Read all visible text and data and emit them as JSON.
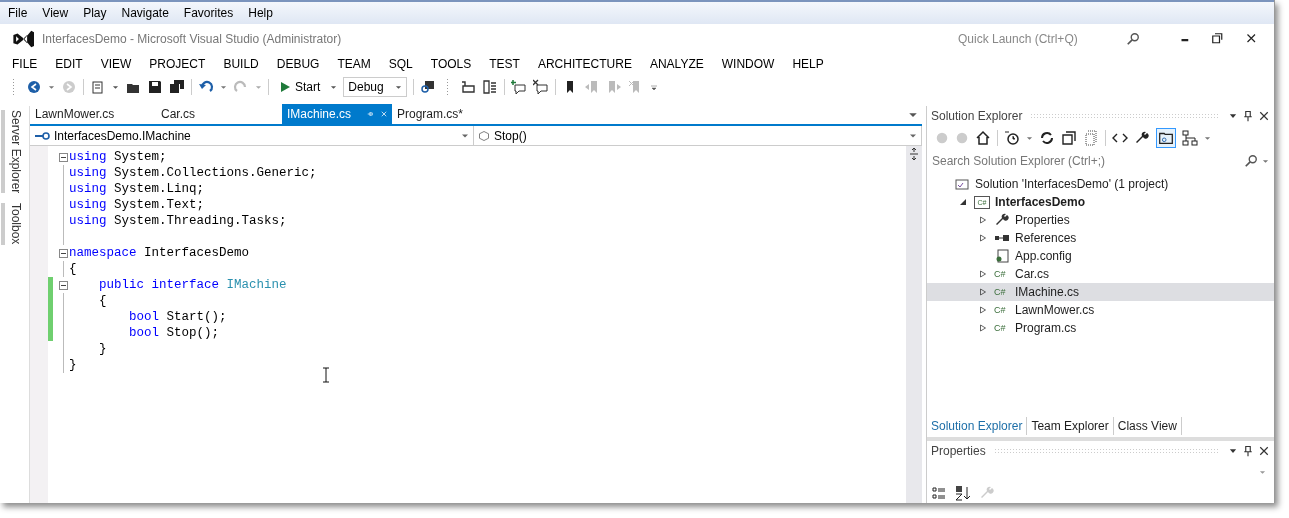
{
  "browser_menu": [
    "File",
    "View",
    "Play",
    "Navigate",
    "Favorites",
    "Help"
  ],
  "window": {
    "title": "InterfacesDemo - Microsoft Visual Studio (Administrator)",
    "quick_launch": {
      "placeholder": "Quick Launch (Ctrl+Q)"
    }
  },
  "menu": [
    "FILE",
    "EDIT",
    "VIEW",
    "PROJECT",
    "BUILD",
    "DEBUG",
    "TEAM",
    "SQL",
    "TOOLS",
    "TEST",
    "ARCHITECTURE",
    "ANALYZE",
    "WINDOW",
    "HELP"
  ],
  "toolbar": {
    "start": "Start",
    "configuration": "Debug"
  },
  "side_tabs": [
    "Server Explorer",
    "Toolbox"
  ],
  "doc_tabs": [
    {
      "label": "LawnMower.cs",
      "selected": false
    },
    {
      "label": "Car.cs",
      "selected": false
    },
    {
      "label": "IMachine.cs",
      "selected": true
    },
    {
      "label": "Program.cs*",
      "selected": false
    }
  ],
  "nav_bar": {
    "type": "InterfacesDemo.IMachine",
    "member": "Stop()"
  },
  "code_lines": [
    {
      "fold": true,
      "changed": false,
      "tokens": [
        {
          "kind": "keyword",
          "text": "using"
        },
        {
          "kind": "plain",
          "text": " System;"
        }
      ]
    },
    {
      "fold": false,
      "changed": false,
      "tokens": [
        {
          "kind": "keyword",
          "text": "using"
        },
        {
          "kind": "plain",
          "text": " System.Collections.Generic;"
        }
      ]
    },
    {
      "fold": false,
      "changed": false,
      "tokens": [
        {
          "kind": "keyword",
          "text": "using"
        },
        {
          "kind": "plain",
          "text": " System.Linq;"
        }
      ]
    },
    {
      "fold": false,
      "changed": false,
      "tokens": [
        {
          "kind": "keyword",
          "text": "using"
        },
        {
          "kind": "plain",
          "text": " System.Text;"
        }
      ]
    },
    {
      "fold": false,
      "changed": false,
      "tokens": [
        {
          "kind": "keyword",
          "text": "using"
        },
        {
          "kind": "plain",
          "text": " System.Threading.Tasks;"
        }
      ]
    },
    {
      "fold": false
    },
    {
      "fold": true,
      "changed": false,
      "tokens": [
        {
          "kind": "keyword",
          "text": "namespace"
        },
        {
          "kind": "plain",
          "text": " InterfacesDemo"
        }
      ]
    },
    {
      "fold": false,
      "changed": false,
      "tokens": [
        {
          "kind": "plain",
          "text": "{"
        }
      ]
    },
    {
      "fold": true,
      "changed": true,
      "tokens": [
        {
          "kind": "keyword",
          "text": "    public"
        },
        {
          "kind": "keyword",
          "text": " interface"
        },
        {
          "kind": "type",
          "text": " IMachine"
        }
      ]
    },
    {
      "fold": false,
      "changed": true,
      "tokens": [
        {
          "kind": "plain",
          "text": "    {"
        }
      ]
    },
    {
      "fold": false,
      "changed": true,
      "tokens": [
        {
          "kind": "keyword",
          "text": "        bool"
        },
        {
          "kind": "plain",
          "text": " Start();"
        }
      ]
    },
    {
      "fold": false,
      "changed": true,
      "tokens": [
        {
          "kind": "keyword",
          "text": "        bool"
        },
        {
          "kind": "plain",
          "text": " Stop();"
        }
      ]
    },
    {
      "fold": false,
      "changed": false,
      "tokens": [
        {
          "kind": "plain",
          "text": "    }"
        }
      ]
    },
    {
      "fold": false,
      "changed": false,
      "tokens": [
        {
          "kind": "plain",
          "text": "}"
        }
      ]
    }
  ],
  "solution_explorer": {
    "title": "Solution Explorer",
    "search": {
      "placeholder": "Search Solution Explorer (Ctrl+;)"
    },
    "tree": [
      {
        "label": "Solution 'InterfacesDemo' (1 project)",
        "kind": "solution",
        "expandable": false,
        "selected": false,
        "children": [
          {
            "label": "InterfacesDemo",
            "kind": "project",
            "icon_text": "C#",
            "expandable": true,
            "expanded": true,
            "selected": false,
            "children": [
              {
                "label": "Properties",
                "kind": "properties",
                "expandable": true,
                "expanded": false,
                "selected": false
              },
              {
                "label": "References",
                "kind": "references",
                "expandable": true,
                "expanded": false,
                "selected": false
              },
              {
                "label": "App.config",
                "kind": "config",
                "expandable": false,
                "selected": false
              },
              {
                "label": "Car.cs",
                "kind": "csharp",
                "icon_text": "C#",
                "expandable": true,
                "expanded": false,
                "selected": false
              },
              {
                "label": "IMachine.cs",
                "kind": "csharp",
                "icon_text": "C#",
                "expandable": true,
                "expanded": false,
                "selected": true
              },
              {
                "label": "LawnMower.cs",
                "kind": "csharp",
                "icon_text": "C#",
                "expandable": true,
                "expanded": false,
                "selected": false
              },
              {
                "label": "Program.cs",
                "kind": "csharp",
                "icon_text": "C#",
                "expandable": true,
                "expanded": false,
                "selected": false
              }
            ]
          }
        ]
      }
    ],
    "bottom_tabs": [
      {
        "label": "Solution Explorer",
        "selected": true
      },
      {
        "label": "Team Explorer",
        "selected": false
      },
      {
        "label": "Class View",
        "selected": false
      }
    ]
  },
  "properties": {
    "title": "Properties"
  }
}
